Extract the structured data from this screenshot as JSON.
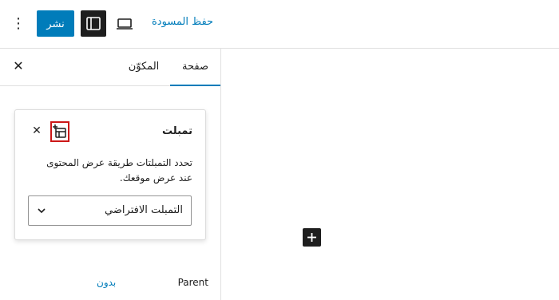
{
  "header": {
    "options_icon": "vertical-ellipsis-icon",
    "publish_label": "نشر",
    "sidebar_toggle_icon": "sidebar-icon",
    "preview_icon": "laptop-icon",
    "save_draft_label": "حفظ المسودة"
  },
  "sidebar": {
    "tabs": [
      {
        "label": "صفحة",
        "active": true
      },
      {
        "label": "المكوّن",
        "active": false
      }
    ],
    "close_icon": "close-icon",
    "template_popover": {
      "title": "تمبلت",
      "add_icon": "add-template-icon",
      "close_icon": "close-icon",
      "description": "تحدد التمبلتات طريقة عرض المحتوى عند عرض موقعك.",
      "select_value": "التمبلت الافتراضي"
    },
    "parent": {
      "label": "Parent",
      "value": "بدون"
    }
  },
  "canvas": {
    "add_block_icon": "plus-icon"
  },
  "colors": {
    "accent": "#007cba",
    "dark": "#1e1e1e",
    "highlight_border": "#cc1818"
  }
}
